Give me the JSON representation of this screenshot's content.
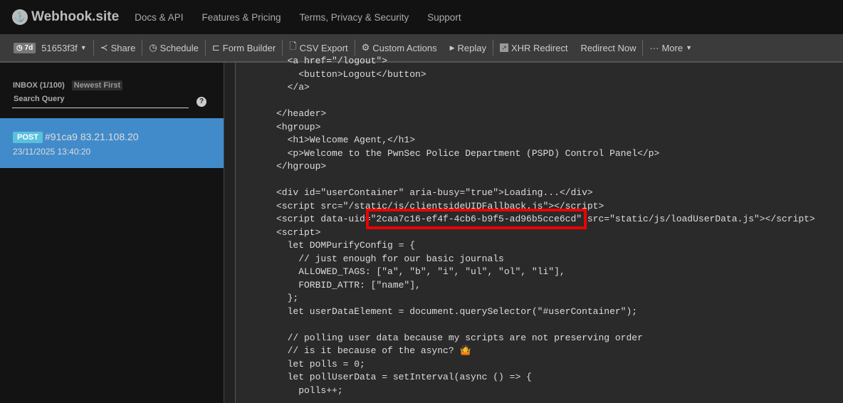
{
  "nav": {
    "brand": "Webhook.site",
    "links": [
      "Docs & API",
      "Features & Pricing",
      "Terms, Privacy & Security",
      "Support"
    ]
  },
  "toolbar": {
    "expiry": "7d",
    "token": "51653f3f",
    "share": "Share",
    "schedule": "Schedule",
    "form_builder": "Form Builder",
    "csv_export": "CSV Export",
    "custom_actions": "Custom Actions",
    "replay": "Replay",
    "xhr_redirect": "XHR Redirect",
    "redirect_now": "Redirect Now",
    "more": "More"
  },
  "sidebar": {
    "inbox": "INBOX (1/100)",
    "sort": "Newest First",
    "search_placeholder": "Search Query",
    "help": "?",
    "requests": [
      {
        "method": "POST",
        "id": "#91ca9 83.21.108.20",
        "date": "23/11/2025 13:40:20"
      }
    ]
  },
  "code": {
    "before": [
      "  <a href=\"/logout\">",
      "    <button>Logout</button>",
      "  </a>",
      "",
      "</header>",
      "<hgroup>",
      "  <h1>Welcome Agent,</h1>",
      "  <p>Welcome to the PwnSec Police Department (PSPD) Control Panel</p>",
      "</hgroup>",
      "",
      "<div id=\"userContainer\" aria-busy=\"true\">Loading...</div>",
      "<script src=\"/static/js/clientsideUIDFallback.js\"></script>"
    ],
    "uid_prefix": "<script data-uid=",
    "uid_value": "\"2caa7c16-ef4f-4cb6-b9f5-ad96b5cce6cd\"",
    "uid_suffix": " src=\"static/js/loadUserData.js\"></script>",
    "after": [
      "<script>",
      "  let DOMPurifyConfig = {",
      "    // just enough for our basic journals",
      "    ALLOWED_TAGS: [\"a\", \"b\", \"i\", \"ul\", \"ol\", \"li\"],",
      "    FORBID_ATTR: [\"name\"],",
      "  };",
      "  let userDataElement = document.querySelector(\"#userContainer\");",
      "",
      "  // polling user data because my scripts are not preserving order",
      "  // is it because of the async? 🤷",
      "  let polls = 0;",
      "  let pollUserData = setInterval(async () => {",
      "    polls++;"
    ]
  }
}
